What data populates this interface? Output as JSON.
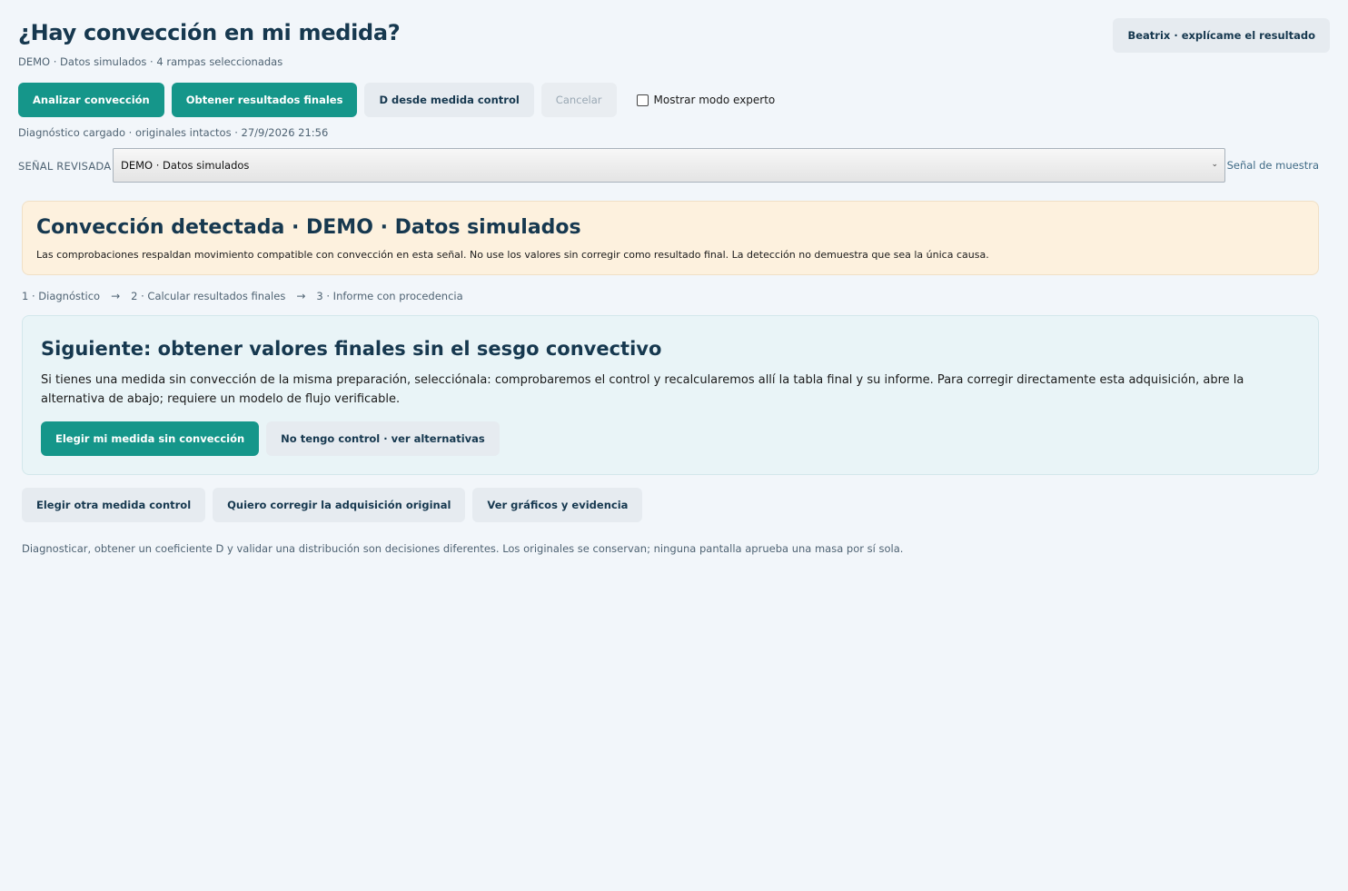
{
  "header": {
    "title": "¿Hay convección en mi medida?",
    "subtitle": "DEMO · Datos simulados · 4 rampas seleccionadas",
    "help_label": "Beatrix · explícame el resultado"
  },
  "toolbar": {
    "analyze_label": "Analizar convección",
    "final_results_label": "Obtener resultados finales",
    "d_control_label": "D desde medida control",
    "cancel_label": "Cancelar",
    "expert_mode_label": "Mostrar modo experto",
    "expert_mode_checked": false
  },
  "status": {
    "text": "Diagnóstico cargado · originales intactos · 27/9/2026 21:56"
  },
  "signal": {
    "label": "SEÑAL REVISADA",
    "selected": "DEMO · Datos simulados",
    "sample_link": "Señal de muestra"
  },
  "alert": {
    "title": "Convección detectada · DEMO · Datos simulados",
    "text": "Las comprobaciones respaldan movimiento compatible con convección en esta señal. No use los valores sin corregir como resultado final. La detección no demuestra que sea la única causa."
  },
  "steps": {
    "items": [
      "1 · Diagnóstico",
      "2 · Calcular resultados finales",
      "3 · Informe con procedencia"
    ],
    "separator": "→"
  },
  "next": {
    "title": "Siguiente: obtener valores finales sin el sesgo convectivo",
    "text": "Si tienes una medida sin convección de la misma preparación, selecciónala: comprobaremos el control y recalcularemos allí la tabla final y su informe. Para corregir directamente esta adquisición, abre la alternativa de abajo; requiere un modelo de flujo verificable.",
    "choose_label": "Elegir mi medida sin convección",
    "alternatives_label": "No tengo control · ver alternativas"
  },
  "bottom": {
    "other_control_label": "Elegir otra medida control",
    "correct_original_label": "Quiero corregir la adquisición original",
    "evidence_label": "Ver gráficos y evidencia",
    "footnote": "Diagnosticar, obtener un coeficiente D y validar una distribución son decisiones diferentes. Los originales se conservan; ninguna pantalla aprueba una masa por sí sola."
  },
  "colors": {
    "primary": "#15968a",
    "title": "#16384f",
    "alert_bg": "#fdf1de",
    "next_bg": "#e9f4f7",
    "page_bg": "#f2f6fa"
  },
  "icons": {
    "select_chevron": "chevron-down-icon",
    "step_arrow": "arrow-right-icon"
  }
}
